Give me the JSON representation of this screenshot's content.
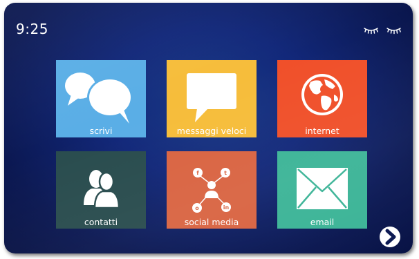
{
  "status": {
    "time": "9:25",
    "sleep_icon": "closed-eyes-icon"
  },
  "tiles": [
    {
      "label": "scrivi",
      "icon": "speech-bubbles-icon",
      "color": "#5aaee6"
    },
    {
      "label": "messaggi veloci",
      "icon": "message-bubble-icon",
      "color": "#f6bd3b"
    },
    {
      "label": "internet",
      "icon": "globe-icon",
      "color": "#f0502a"
    },
    {
      "label": "contatti",
      "icon": "contacts-icon",
      "color": "#294c4e"
    },
    {
      "label": "social media",
      "icon": "social-network-icon",
      "color": "#d96442"
    },
    {
      "label": "email",
      "icon": "envelope-icon",
      "color": "#3cb497"
    }
  ],
  "navigation": {
    "next_icon": "chevron-right-icon"
  }
}
